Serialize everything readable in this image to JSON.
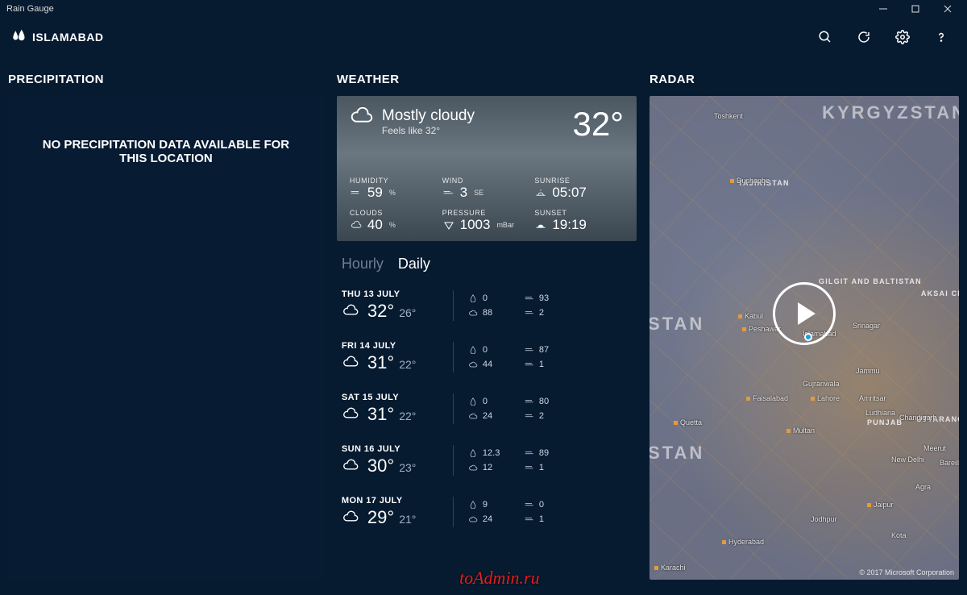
{
  "window": {
    "title": "Rain Gauge"
  },
  "header": {
    "location": "ISLAMABAD"
  },
  "sections": {
    "precipitation": "PRECIPITATION",
    "weather": "WEATHER",
    "radar": "RADAR"
  },
  "precipitation": {
    "message": "NO PRECIPITATION DATA AVAILABLE FOR THIS LOCATION"
  },
  "current": {
    "condition": "Mostly cloudy",
    "feels_like": "Feels like 32°",
    "temp": "32°",
    "stats": {
      "humidity": {
        "label": "HUMIDITY",
        "value": "59",
        "unit": "%"
      },
      "wind": {
        "label": "WIND",
        "value": "3",
        "unit": "SE"
      },
      "sunrise": {
        "label": "SUNRISE",
        "value": "05:07"
      },
      "clouds": {
        "label": "CLOUDS",
        "value": "40",
        "unit": "%"
      },
      "pressure": {
        "label": "PRESSURE",
        "value": "1003",
        "unit": "mBar"
      },
      "sunset": {
        "label": "SUNSET",
        "value": "19:19"
      }
    }
  },
  "tabs": {
    "hourly": "Hourly",
    "daily": "Daily",
    "active": "daily"
  },
  "daily": [
    {
      "date": "THU 13 JULY",
      "hi": "32°",
      "lo": "26°",
      "rain": "0",
      "clouds": "88",
      "wind_hi": "93",
      "wind_lo": "2"
    },
    {
      "date": "FRI 14 JULY",
      "hi": "31°",
      "lo": "22°",
      "rain": "0",
      "clouds": "44",
      "wind_hi": "87",
      "wind_lo": "1"
    },
    {
      "date": "SAT 15 JULY",
      "hi": "31°",
      "lo": "22°",
      "rain": "0",
      "clouds": "24",
      "wind_hi": "80",
      "wind_lo": "2"
    },
    {
      "date": "SUN 16 JULY",
      "hi": "30°",
      "lo": "23°",
      "rain": "12.3",
      "clouds": "12",
      "wind_hi": "89",
      "wind_lo": "1"
    },
    {
      "date": "MON 17 JULY",
      "hi": "29°",
      "lo": "21°",
      "rain": "9",
      "clouds": "24",
      "wind_hi": "0",
      "wind_lo": "1"
    }
  ],
  "radar": {
    "credit": "© 2017 Microsoft Corporation",
    "countries": [
      "KYRGYZSTAN",
      "STAN",
      "STAN"
    ],
    "regions": [
      "TAJIKISTAN",
      "GILGIT AND BALTISTAN",
      "PUNJAB",
      "UTTARANC",
      "AKSAI CH"
    ],
    "cities": [
      "Toshkent",
      "Dushanbe",
      "Kabul",
      "Peshawar",
      "Islamabad",
      "Srinagar",
      "Jammu",
      "Gujranwala",
      "Lahore",
      "Amritsar",
      "Faisalabad",
      "Ludhiana",
      "Chandigarh",
      "Quetta",
      "Multan",
      "Meerut",
      "New Delhi",
      "Bareilly",
      "Agra",
      "Jaipur",
      "Jodhpur",
      "Hyderabad",
      "Kota",
      "Karachi"
    ]
  },
  "watermark": "toAdmin.ru"
}
